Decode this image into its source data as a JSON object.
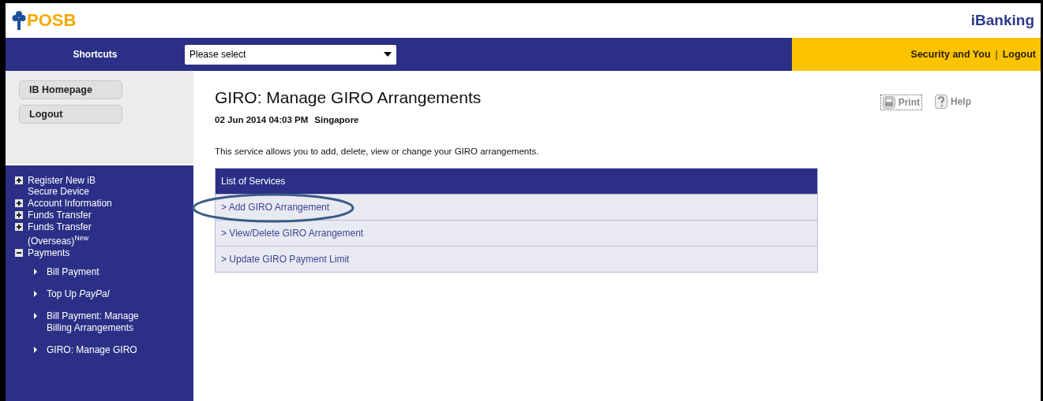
{
  "header": {
    "logo": "POSB",
    "product": "iBanking"
  },
  "nav": {
    "shortcuts_label": "Shortcuts",
    "select": {
      "value": "Please select"
    },
    "links": [
      "Security and You",
      "Logout"
    ],
    "separator": "|"
  },
  "sidebar": {
    "buttons": [
      "IB Homepage",
      "Logout"
    ],
    "menu": [
      {
        "label": "Register New iB Secure Device",
        "expanded": false
      },
      {
        "label": "Account Information",
        "expanded": false
      },
      {
        "label": "Funds Transfer",
        "expanded": false
      },
      {
        "label": "Funds Transfer (Overseas)$^{New}$",
        "expanded": false
      },
      {
        "label": "Payments",
        "expanded": true,
        "children": [
          {
            "label": "Bill Payment"
          },
          {
            "label": "Top Up *PayPal*"
          },
          {
            "label": "Bill Payment: Manage Billing Arrangements"
          },
          {
            "label": "GIRO: Manage GIRO"
          }
        ]
      }
    ]
  },
  "main": {
    "title": "GIRO: Manage GIRO Arrangements",
    "datetime": "02 Jun 2014 04:03 PM",
    "location": "Singapore",
    "tools": [
      "Print",
      "Help"
    ],
    "description": "This service allows you to add, delete, view or change your GIRO arrangements.",
    "services": {
      "heading": "List of Services",
      "items": [
        {
          "label": "> Add GIRO Arrangement",
          "highlighted": true
        },
        {
          "label": "> View/Delete GIRO Arrangement",
          "highlighted": false
        },
        {
          "label": "> Update GIRO Payment Limit",
          "highlighted": false
        }
      ]
    }
  }
}
